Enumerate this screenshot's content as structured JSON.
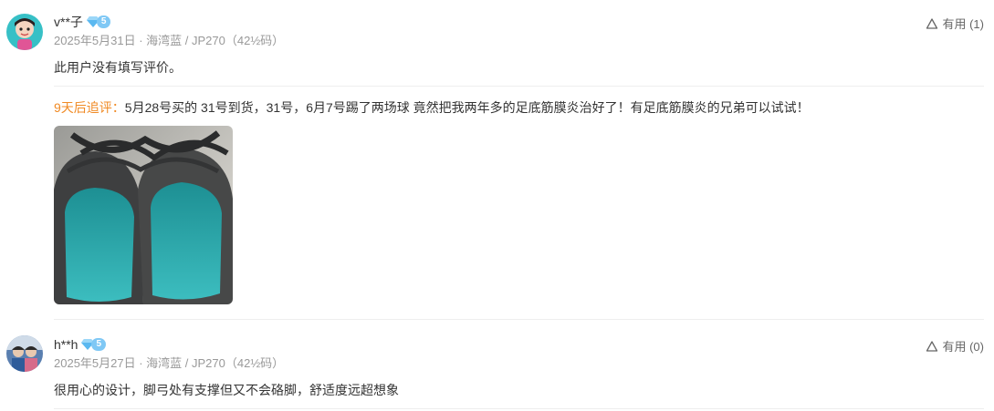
{
  "reviews": [
    {
      "username": "v**子",
      "vip_level": "5",
      "meta": "2025年5月31日 · 海湾蓝 / JP270（42½码）",
      "content": "此用户没有填写评价。",
      "followup_tag": "9天后追评：",
      "followup_text": "5月28号买的 31号到货，31号，6月7号踢了两场球 竟然把我两年多的足底筋膜炎治好了！有足底筋膜炎的兄弟可以试试！",
      "helpful_label": "有用 (1)"
    },
    {
      "username": "h**h",
      "vip_level": "5",
      "meta": "2025年5月27日 · 海湾蓝 / JP270（42½码）",
      "content": "很用心的设计，脚弓处有支撑但又不会硌脚，舒适度远超想象",
      "helpful_label": "有用 (0)"
    }
  ],
  "colors": {
    "followup_tag": "#f08a24",
    "meta_text": "#999999",
    "vip_badge": "#7fc8f5",
    "insole_teal": "#2aa5a8"
  },
  "icons": {
    "helpful": "thumbs-up-triangle-icon",
    "vip": "diamond-icon"
  }
}
